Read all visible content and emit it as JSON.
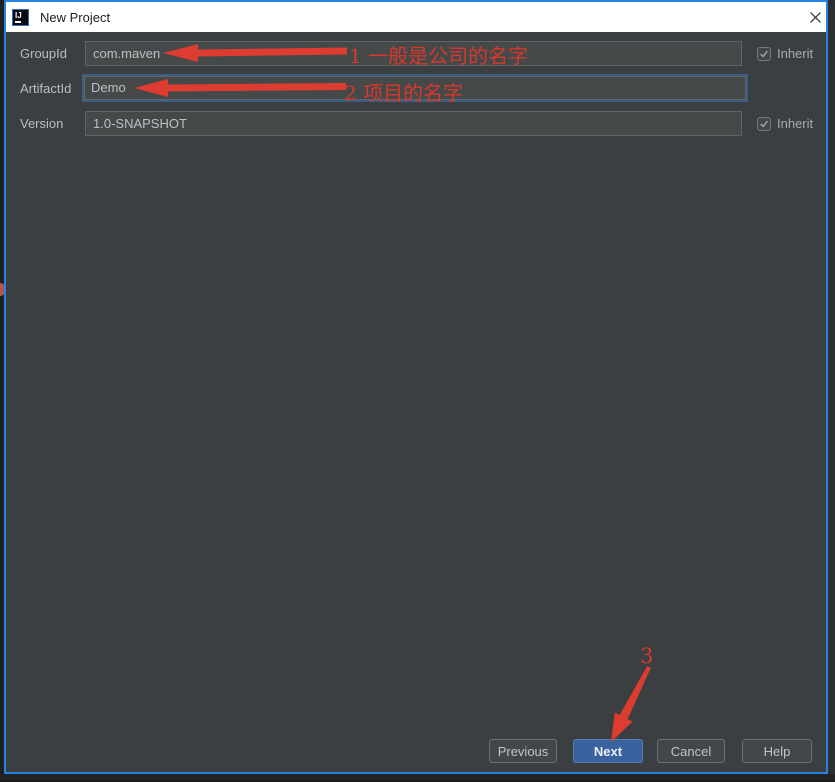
{
  "window": {
    "title": "New Project",
    "logo_text": "IJ"
  },
  "form": {
    "groupId": {
      "label": "GroupId",
      "value": "com.maven",
      "inherit_label": "Inherit",
      "inherit_checked": true
    },
    "artifactId": {
      "label": "ArtifactId",
      "value": "Demo",
      "focused": true
    },
    "version": {
      "label": "Version",
      "value": "1.0-SNAPSHOT",
      "inherit_label": "Inherit",
      "inherit_checked": true
    }
  },
  "buttons": {
    "previous": "Previous",
    "next": "Next",
    "cancel": "Cancel",
    "help": "Help"
  },
  "annotations": {
    "note1": "1 一般是公司的名字",
    "note2": "2 项目的名字",
    "note3": "3",
    "red": "#d8382b"
  },
  "colors": {
    "window_border_blue": "#2384e0",
    "dialog_background": "#3c3f41",
    "field_background": "#45494a",
    "focus_border_blue": "#3c5e84",
    "next_button_blue": "#39629f",
    "titlebar_white": "#ffffff"
  }
}
